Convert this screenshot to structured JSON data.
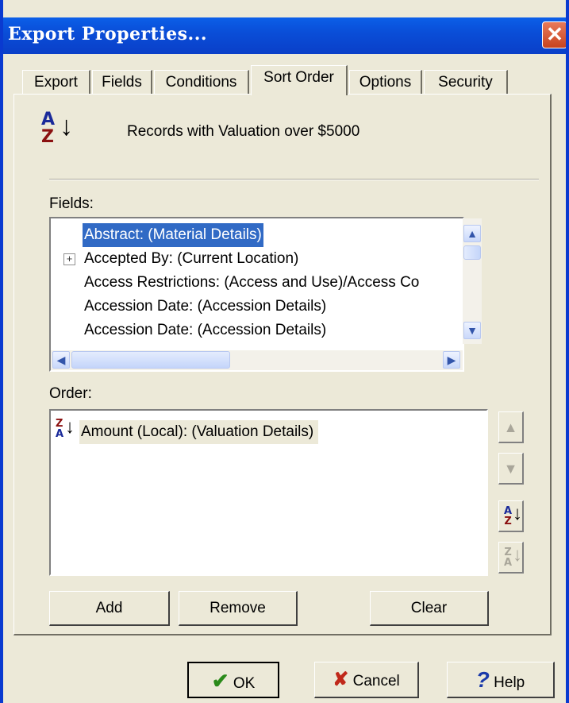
{
  "window": {
    "title": "Export Properties...",
    "close_glyph": "✕"
  },
  "tabs": [
    {
      "label": "Export"
    },
    {
      "label": "Fields"
    },
    {
      "label": "Conditions"
    },
    {
      "label": "Sort Order",
      "active": true
    },
    {
      "label": "Options"
    },
    {
      "label": "Security"
    }
  ],
  "header": {
    "description": "Records with Valuation over $5000",
    "icon": "sort-ascending-icon"
  },
  "fields": {
    "label": "Fields:",
    "items": [
      {
        "text": "Abstract: (Material Details)",
        "selected": true,
        "expandable": false
      },
      {
        "text": "Accepted By: (Current Location)",
        "selected": false,
        "expandable": true
      },
      {
        "text": "Access Restrictions: (Access and Use)/Access Co",
        "selected": false,
        "expandable": false
      },
      {
        "text": "Accession Date: (Accession Details)",
        "selected": false,
        "expandable": false
      },
      {
        "text": "Accession Date: (Accession Details)",
        "selected": false,
        "expandable": false
      }
    ]
  },
  "order": {
    "label": "Order:",
    "items": [
      {
        "text": "Amount (Local): (Valuation Details)",
        "direction": "descending"
      }
    ]
  },
  "buttons": {
    "add": "Add",
    "remove": "Remove",
    "clear": "Clear"
  },
  "footer": {
    "ok": "OK",
    "cancel": "Cancel",
    "help": "Help"
  },
  "colors": {
    "title_bar": "#0a4ed8",
    "selection": "#316ac5",
    "face": "#ece9d8"
  }
}
